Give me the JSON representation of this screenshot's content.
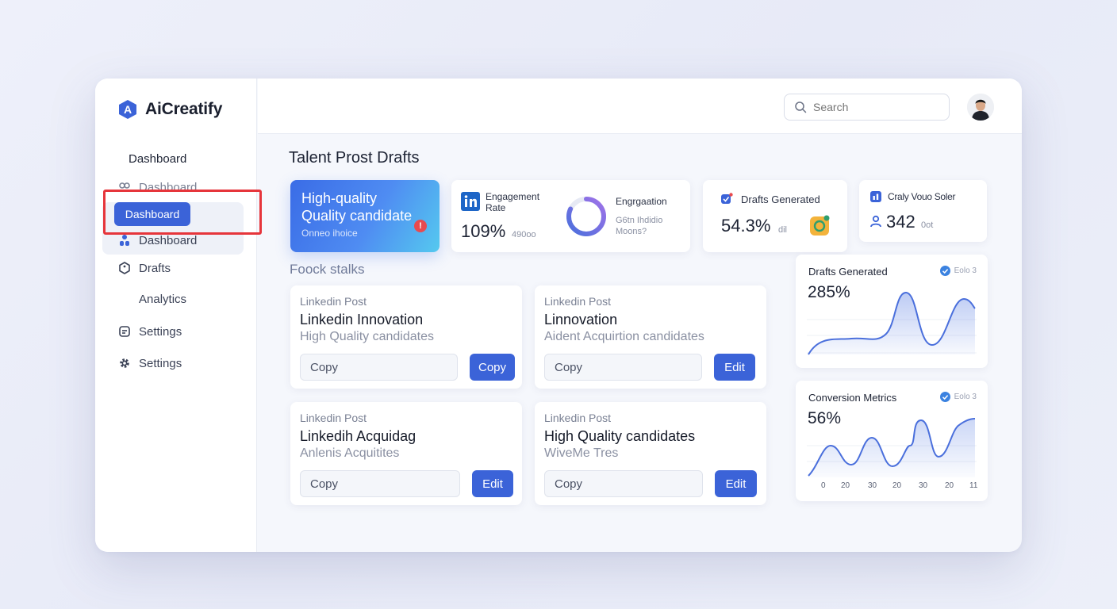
{
  "brand": {
    "name": "AiCreatify"
  },
  "sidebar": {
    "items": [
      {
        "label": "Dashboard",
        "icon": "none"
      },
      {
        "label": "Dashboard",
        "icon": "people-icon"
      },
      {
        "label": "Dashboard",
        "icon": "none",
        "active": true
      },
      {
        "label": "Dashboard",
        "icon": "users-icon"
      },
      {
        "label": "Drafts",
        "icon": "hexagon-icon"
      },
      {
        "label": "Analytics",
        "icon": "none"
      },
      {
        "label": "Settings",
        "icon": "calendar-icon"
      },
      {
        "label": "Settings",
        "icon": "gear-icon"
      }
    ]
  },
  "header": {
    "search_placeholder": "Search",
    "avatar_icon": "user-avatar"
  },
  "main": {
    "title": "Talent Prost Drafts",
    "hero": {
      "title_line1": "High-quality",
      "title_line2": "Quality candidate",
      "subtitle": "Onneo ihoice",
      "alert": "!"
    },
    "engagement": {
      "label_line1": "Engagement",
      "label_line2": "Rate",
      "value": "109%",
      "extra": "490oo",
      "donut_title": "Engrgaation",
      "donut_sub1": "G6tn Ihdidio",
      "donut_sub2": "Moons?",
      "donut_fraction": 0.82
    },
    "drafts_generated_stat": {
      "label": "Drafts Generated",
      "value": "54.3%",
      "extra": "dil"
    },
    "crafty": {
      "label": "Craly Vouo Soler",
      "value": "342",
      "extra": "0ot"
    },
    "section_title": "Foock stalks",
    "posts": [
      {
        "type": "Linkedin Post",
        "title": "Linkedin Innovation",
        "subtitle": "High Quality candidates",
        "field": "Copy",
        "button": "Copy"
      },
      {
        "type": "Linkedin Post",
        "title": "Linnovation",
        "subtitle": "Aident Acquirtion candidates",
        "field": "Copy",
        "button": "Edit"
      },
      {
        "type": "Linkedin Post",
        "title": "Linkedih Acquidag",
        "subtitle": "Anlenis Acquitites",
        "field": "Copy",
        "button": "Edit"
      },
      {
        "type": "Linkedin Post",
        "title": "High Quality candidates",
        "subtitle": "WiveMe Tres",
        "field": "Copy",
        "button": "Edit"
      }
    ],
    "charts": [
      {
        "title": "Drafts Generated",
        "badge": "Eolo 3",
        "value": "285%"
      },
      {
        "title": "Conversion Metrics",
        "badge": "Eolo 3",
        "value": "56%",
        "ticks": [
          "0",
          "20",
          "30",
          "20",
          "30",
          "20",
          "11"
        ]
      }
    ]
  },
  "colors": {
    "accent": "#3b63d8",
    "alert": "#e6353b",
    "chart_line": "#4a6fdc"
  }
}
